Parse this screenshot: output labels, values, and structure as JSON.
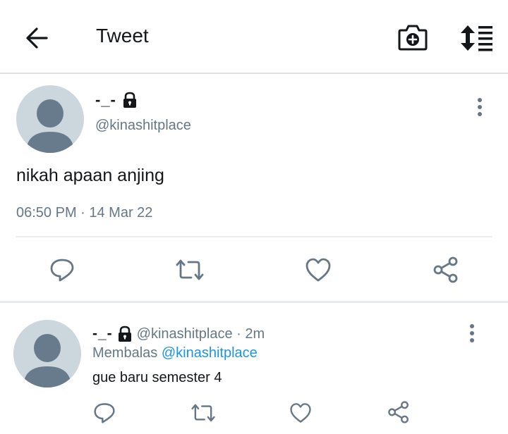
{
  "header": {
    "title": "Tweet",
    "back_icon": "arrow-left-icon",
    "camera_icon": "camera-add-icon",
    "sort_icon": "sort-list-icon"
  },
  "tweet": {
    "name": "-_-",
    "handle": "@kinashitplace",
    "text": "nikah apaan anjing",
    "timestamp": "06:50 PM · 14 Mar 22",
    "actions": [
      "reply-icon",
      "retweet-icon",
      "like-icon",
      "share-icon"
    ]
  },
  "reply": {
    "name": "-_-",
    "handle_time": "@kinashitplace · 2m",
    "replying_prefix": "Membalas",
    "replying_mention": "@kinashitplace",
    "text": "gue baru semester 4",
    "actions": [
      "reply-icon",
      "retweet-icon",
      "like-icon",
      "share-icon"
    ]
  },
  "colors": {
    "icon": "#14171a",
    "muted": "#657786",
    "link": "#1b95e0",
    "avatar_bg": "#ccd6dd",
    "avatar_fg": "#687b8c",
    "divider": "#e6ecf0"
  }
}
